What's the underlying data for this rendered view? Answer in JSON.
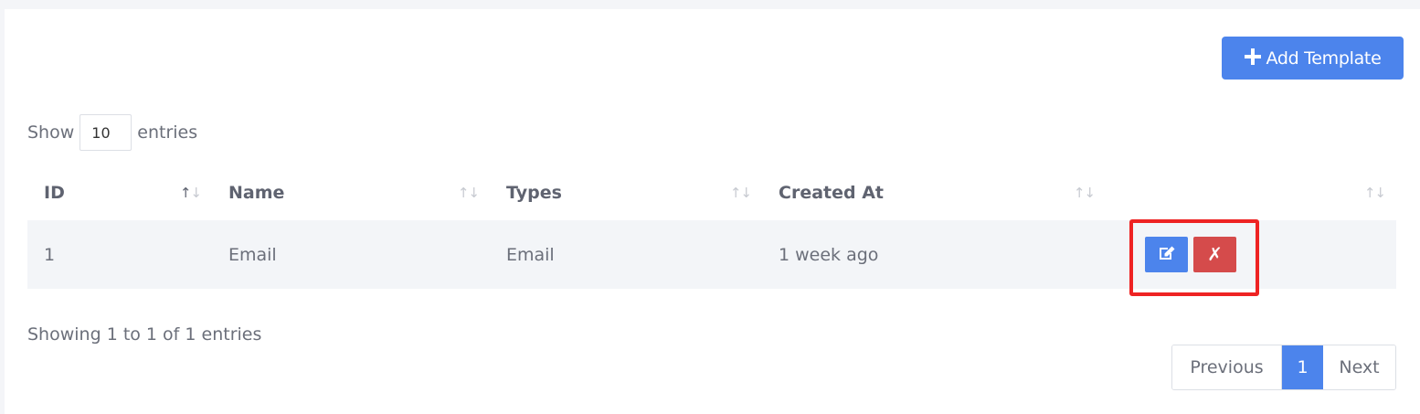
{
  "toolbar": {
    "add_label": "Add Template",
    "add_icon": "plus-icon"
  },
  "length": {
    "prefix": "Show",
    "value": "10",
    "suffix": "entries"
  },
  "table": {
    "columns": [
      "ID",
      "Name",
      "Types",
      "Created At",
      ""
    ],
    "rows": [
      {
        "id": "1",
        "name": "Email",
        "type": "Email",
        "created": "1 week ago",
        "delete_glyph": "✗"
      }
    ]
  },
  "info": "Showing 1 to 1 of 1 entries",
  "pagination": {
    "previous": "Previous",
    "current": "1",
    "next": "Next"
  },
  "colors": {
    "primary": "#4c84ec",
    "danger": "#d54b4b",
    "highlight": "#ee2323"
  }
}
